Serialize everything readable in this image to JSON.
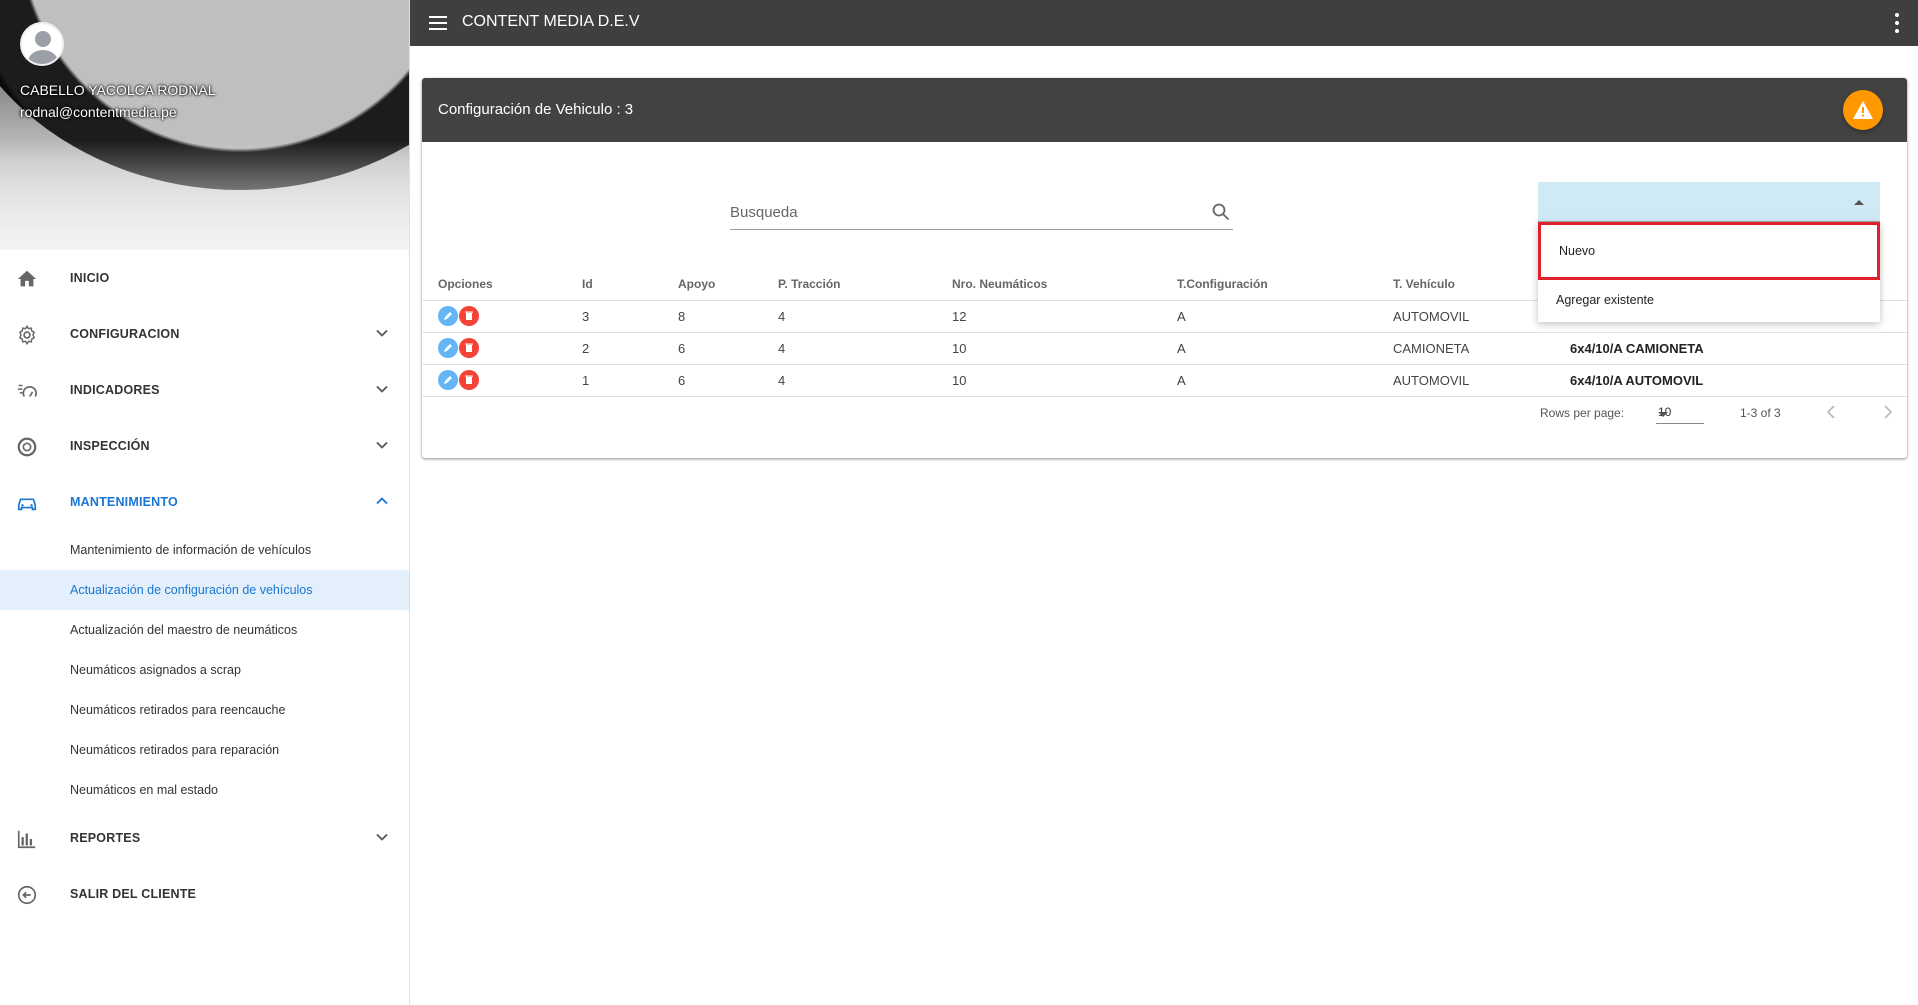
{
  "app": {
    "title": "CONTENT MEDIA D.E.V"
  },
  "profile": {
    "name": "CABELLO YACOLCA RODNAL",
    "email": "rodnal@contentmedia.pe"
  },
  "sidebar": {
    "items": [
      {
        "label": "INICIO",
        "icon": "home-icon"
      },
      {
        "label": "CONFIGURACION",
        "icon": "gear-icon"
      },
      {
        "label": "INDICADORES",
        "icon": "speed-icon"
      },
      {
        "label": "INSPECCIÓN",
        "icon": "tire-icon"
      },
      {
        "label": "MANTENIMIENTO",
        "icon": "car-repair-icon"
      },
      {
        "label": "REPORTES",
        "icon": "bar-chart-icon"
      },
      {
        "label": "SALIR DEL CLIENTE",
        "icon": "exit-icon"
      }
    ],
    "sub_items": [
      "Mantenimiento de información de vehículos",
      "Actualización de configuración de vehículos",
      "Actualización del maestro de neumáticos",
      "Neumáticos asignados a scrap",
      "Neumáticos retirados para reencauche",
      "Neumáticos retirados para reparación",
      "Neumáticos en mal estado"
    ]
  },
  "card": {
    "title": "Configuración de Vehiculo : 3",
    "search_placeholder": "Busqueda"
  },
  "table": {
    "headers": [
      "Opciones",
      "Id",
      "Apoyo",
      "P. Tracción",
      "Nro. Neumáticos",
      "T.Configuración",
      "T. Vehículo",
      ""
    ],
    "rows": [
      [
        "3",
        "8",
        "4",
        "12",
        "A",
        "AUTOMOVIL",
        ""
      ],
      [
        "2",
        "6",
        "4",
        "10",
        "A",
        "CAMIONETA",
        "6x4/10/A CAMIONETA"
      ],
      [
        "1",
        "6",
        "4",
        "10",
        "A",
        "AUTOMOVIL",
        "6x4/10/A AUTOMOVIL"
      ]
    ]
  },
  "pager": {
    "rows_per_page_label": "Rows per page:",
    "rows_per_page": "10",
    "range": "1-3 of 3"
  },
  "dropdown": {
    "options": [
      "Nuevo",
      "Agregar existente"
    ]
  },
  "colors": {
    "accent": "#1976d2",
    "header": "#3f3f3f",
    "warn": "#ff9800",
    "danger": "#f44336",
    "edit": "#64b5f6",
    "highlight": "#e0202a"
  }
}
